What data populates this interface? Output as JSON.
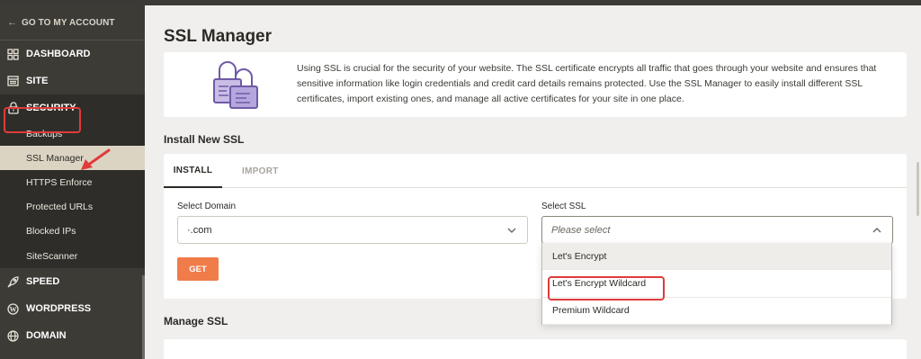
{
  "sidebar": {
    "back_label": "GO TO MY ACCOUNT",
    "items": [
      {
        "label": "DASHBOARD",
        "icon": "grid-icon"
      },
      {
        "label": "SITE",
        "icon": "window-icon"
      },
      {
        "label": "SECURITY",
        "icon": "lock-icon"
      }
    ],
    "security_sub": [
      {
        "label": "Backups"
      },
      {
        "label": "SSL Manager"
      },
      {
        "label": "HTTPS Enforce"
      },
      {
        "label": "Protected URLs"
      },
      {
        "label": "Blocked IPs"
      },
      {
        "label": "SiteScanner"
      }
    ],
    "more_items": [
      {
        "label": "SPEED",
        "icon": "rocket-icon"
      },
      {
        "label": "WORDPRESS",
        "icon": "wordpress-icon"
      },
      {
        "label": "DOMAIN",
        "icon": "globe-icon"
      }
    ]
  },
  "main": {
    "title": "SSL Manager",
    "info_text": "Using SSL is crucial for the security of your website. The SSL certificate encrypts all traffic that goes through your website and ensures that sensitive information like login credentials and credit card details remains protected. Use the SSL Manager to easily install different SSL certificates, import existing ones, and manage all active certificates for your site in one place.",
    "install_heading": "Install New SSL",
    "tabs": [
      "INSTALL",
      "IMPORT"
    ],
    "select_domain_label": "Select Domain",
    "select_domain_value": "·.com",
    "select_ssl_label": "Select SSL",
    "select_ssl_placeholder": "Please select",
    "ssl_options": [
      "Let's Encrypt",
      "Let's Encrypt Wildcard",
      "Premium Wildcard"
    ],
    "get_button": "GET",
    "manage_heading": "Manage SSL"
  },
  "colors": {
    "sidebar_bg": "#3d3b36",
    "accent": "#f07c4a",
    "highlight": "#e03b3b"
  }
}
